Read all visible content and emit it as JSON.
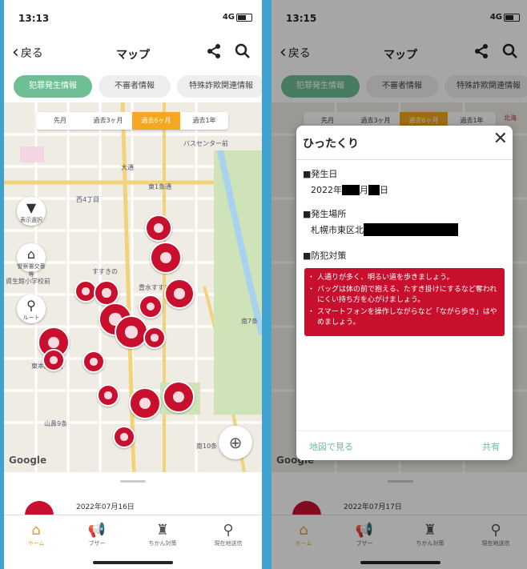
{
  "screen1": {
    "status": {
      "time": "13:13",
      "network": "4G"
    },
    "nav": {
      "back": "戻る",
      "title": "マップ"
    },
    "tabs": [
      "犯罪発生情報",
      "不審者情報",
      "特殊詐欺関連情報"
    ],
    "periods": [
      "先月",
      "過去3ヶ月",
      "過去6ヶ月",
      "過去1年"
    ],
    "selected_period": "過去6ヶ月",
    "map_buttons": [
      {
        "label": "表示選択",
        "icon": "filter-icon"
      },
      {
        "label": "警察署交番等",
        "icon": "police-icon"
      },
      {
        "label": "ルート",
        "icon": "route-icon"
      }
    ],
    "map_labels": [
      "バスセンター前",
      "大通",
      "西4丁目",
      "東1条通",
      "すすきの",
      "豊水すすきの",
      "資生館小学校前",
      "東本願寺前",
      "山鼻9条",
      "南7条",
      "南10条"
    ],
    "google": "Google",
    "sheet_date": "2022年07月16日"
  },
  "screen2": {
    "status": {
      "time": "13:15",
      "network": "4G"
    },
    "nav": {
      "back": "戻る",
      "title": "マップ"
    },
    "tabs": [
      "犯罪発生情報",
      "不審者情報",
      "特殊詐欺関連情報"
    ],
    "periods": [
      "先月",
      "過去3ヶ月",
      "過去6ヶ月",
      "過去1年"
    ],
    "map_label_top": "北海",
    "google": "Google",
    "modal": {
      "title": "ひったくり",
      "date_label": "■発生日",
      "date_value_prefix": "2022年",
      "date_value_month": "月",
      "date_value_day": "日",
      "place_label": "■発生場所",
      "place_value": "札幌市東区北",
      "prevention_label": "■防犯対策",
      "advice": [
        "人通りが多く、明るい道を歩きましょう。",
        "バッグは体の前で抱える、たすき掛けにするなど奪われにくい持ち方を心がけましょう。",
        "スマートフォンを操作しながらなど「ながら歩き」はやめましょう。"
      ],
      "footer_left": "地図で見る",
      "footer_right": "共有"
    },
    "sheet_date": "2022年07月17日"
  },
  "bottom_nav": [
    {
      "label": "ホーム",
      "icon": "home-icon"
    },
    {
      "label": "ブザー",
      "icon": "buzzer-icon"
    },
    {
      "label": "ちかん対策",
      "icon": "chikan-icon"
    },
    {
      "label": "現在地送信",
      "icon": "location-pin-icon"
    }
  ],
  "colors": {
    "accent": "#6fbf94",
    "incident_red": "#c8102e",
    "period_orange": "#f5a623",
    "nav_active": "#d8a32a"
  }
}
